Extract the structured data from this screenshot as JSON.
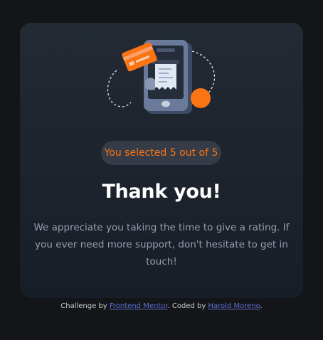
{
  "card": {
    "illustration": "payment-illustration",
    "selection_text": "You selected 5 out of 5",
    "title": "Thank you!",
    "description": "We appreciate you taking the time to give a rating. If you ever need more support, don't hesitate to get in touch!"
  },
  "attribution": {
    "prefix": "Challenge by",
    "link1": "Frontend Mentor",
    "middle": ". Coded by",
    "link2": "Harold Moreno",
    "suffix": "."
  },
  "colors": {
    "background": "#131518",
    "card_top": "#232a34",
    "card_bottom": "#181e27",
    "accent_orange": "#fb7413",
    "pill_bg": "#363c47",
    "text_gray": "#959eac",
    "link": "#5f6fd6"
  }
}
